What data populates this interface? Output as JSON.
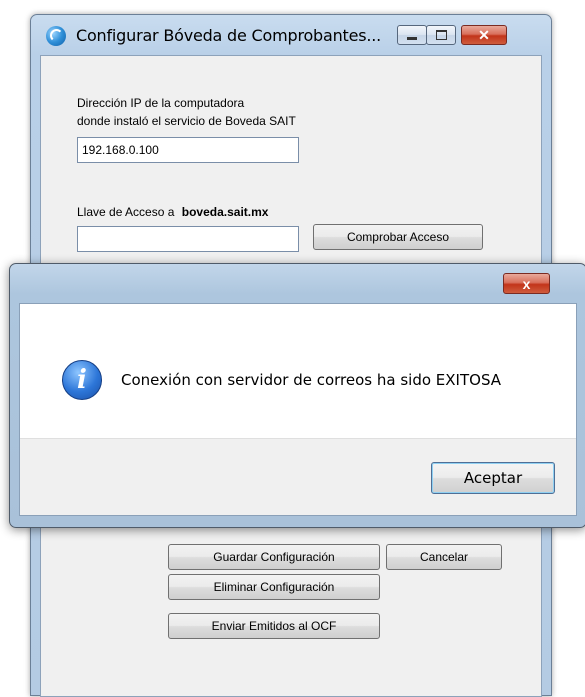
{
  "window": {
    "title": "Configurar Bóveda de Comprobantes...",
    "icon": "app-disc-icon"
  },
  "form": {
    "ip_label_line1": "Dirección IP de la computadora",
    "ip_label_line2": "donde instaló el servicio de Boveda SAIT",
    "ip_value": "192.168.0.100",
    "key_label": "Llave de Acceso a",
    "key_domain": "boveda.sait.mx",
    "key_value": "",
    "check_button": "Comprobar Acceso",
    "save_button": "Guardar Configuración",
    "cancel_button": "Cancelar",
    "delete_button": "Eliminar Configuración",
    "send_button": "Enviar Emitidos al OCF"
  },
  "dialog": {
    "icon": "information-icon",
    "message": "Conexión con servidor de correos ha sido EXITOSA",
    "ok_button": "Aceptar",
    "close_glyph": "x"
  }
}
